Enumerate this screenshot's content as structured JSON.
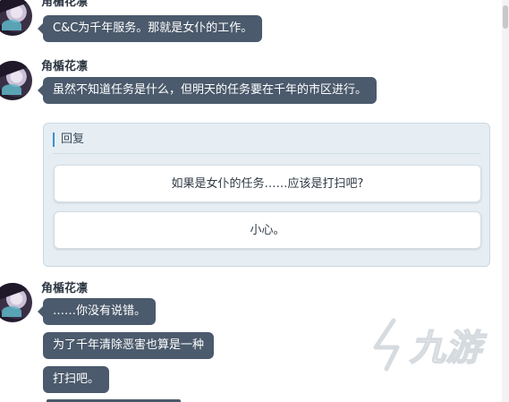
{
  "messages": [
    {
      "speaker": "角楯花凛",
      "lines": [
        "C&C为千年服务。那就是女仆的工作。"
      ]
    },
    {
      "speaker": "角楯花凛",
      "lines": [
        "虽然不知道任务是什么，但明天的任务要在千年的市区进行。"
      ]
    },
    {
      "speaker": "角楯花凛",
      "lines": [
        "……你没有说错。",
        "为了千年清除恶害也算是一种",
        "打扫吧。"
      ]
    }
  ],
  "reply": {
    "title": "回复",
    "options": [
      "如果是女仆的任务……应该是打扫吧?",
      "小心。"
    ]
  },
  "watermark": {
    "text": "九游",
    "icon": "9game-logo-icon"
  }
}
